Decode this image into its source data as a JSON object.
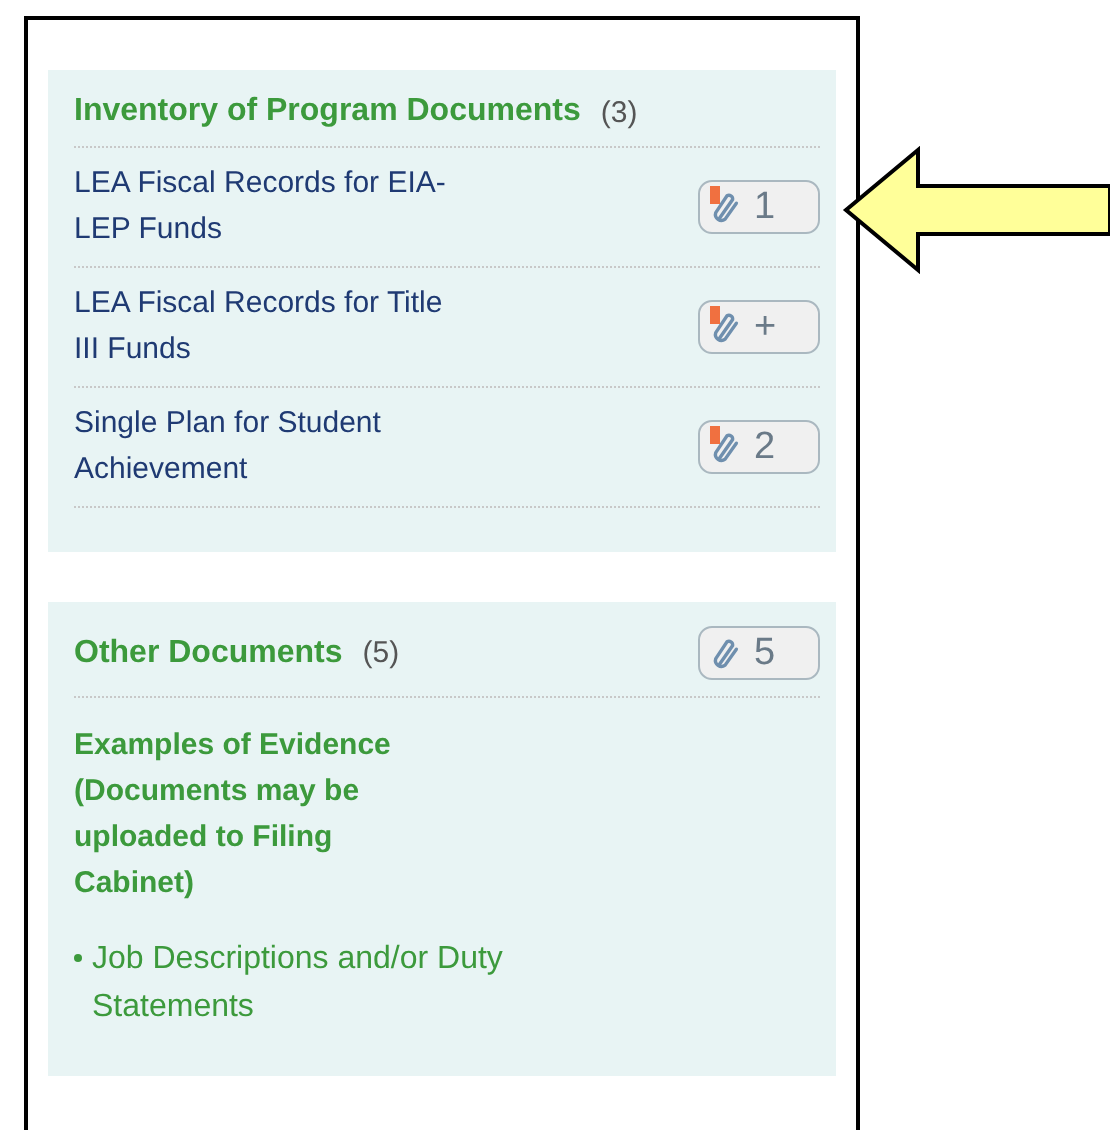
{
  "sections": [
    {
      "title": "Inventory of Program Documents",
      "count": "(3)",
      "items": [
        {
          "label": "LEA Fiscal Records for EIA-LEP Funds",
          "badge": {
            "text": "1",
            "flagged": true,
            "pointed": true
          }
        },
        {
          "label": "LEA Fiscal Records for Title III Funds",
          "badge": {
            "text": "+",
            "flagged": true
          }
        },
        {
          "label": "Single Plan for Student Achievement",
          "badge": {
            "text": "2",
            "flagged": true
          }
        }
      ]
    },
    {
      "title": "Other Documents",
      "count": "(5)",
      "badge": {
        "text": "5",
        "flagged": false
      },
      "subheading": "Examples of Evidence (Documents may be uploaded to Filing Cabinet)",
      "bullets": [
        "Job Descriptions and/or Duty Statements"
      ]
    }
  ]
}
